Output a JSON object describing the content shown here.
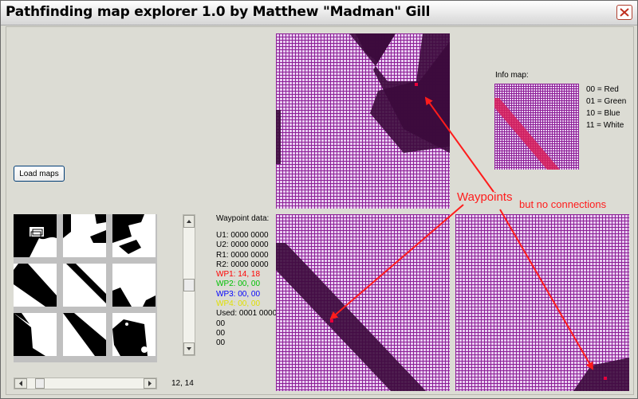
{
  "window": {
    "title": "Pathfinding map explorer 1.0 by Matthew \"Madman\" Gill"
  },
  "toolbar": {
    "load_maps_label": "Load maps"
  },
  "minimap": {
    "coords": "12, 14"
  },
  "waypoint_data": {
    "title": "Waypoint data:",
    "lines": [
      {
        "text": "U1: 0000 0000",
        "color": "#000000"
      },
      {
        "text": "U2: 0000 0000",
        "color": "#000000"
      },
      {
        "text": "R1: 0000 0000",
        "color": "#000000"
      },
      {
        "text": "R2: 0000 0000",
        "color": "#000000"
      },
      {
        "text": "WP1: 14, 18",
        "color": "#ff0000"
      },
      {
        "text": "WP2: 00, 00",
        "color": "#00c000"
      },
      {
        "text": "WP3: 00, 00",
        "color": "#0000ff"
      },
      {
        "text": "WP4: 00, 00",
        "color": "#e0e000"
      },
      {
        "text": "Used: 0001 0000",
        "color": "#000000"
      },
      {
        "text": "00",
        "color": "#000000"
      },
      {
        "text": "00",
        "color": "#000000"
      },
      {
        "text": "00",
        "color": "#000000"
      }
    ]
  },
  "info_map": {
    "title": "Info map:",
    "legend": [
      "00 = Red",
      "01 = Green",
      "10 = Blue",
      "11 = White"
    ]
  },
  "annotations": {
    "waypoints_label": "Waypoints",
    "no_connections_label": "but no connections",
    "color": "#ff1c1c"
  },
  "colors": {
    "walkable": "#e8ccf0",
    "grid_line": "#8c1e96",
    "blocked": "#3c0a3c",
    "info_fill": "#d8205a",
    "waypoint_dot": "#e8003c"
  }
}
